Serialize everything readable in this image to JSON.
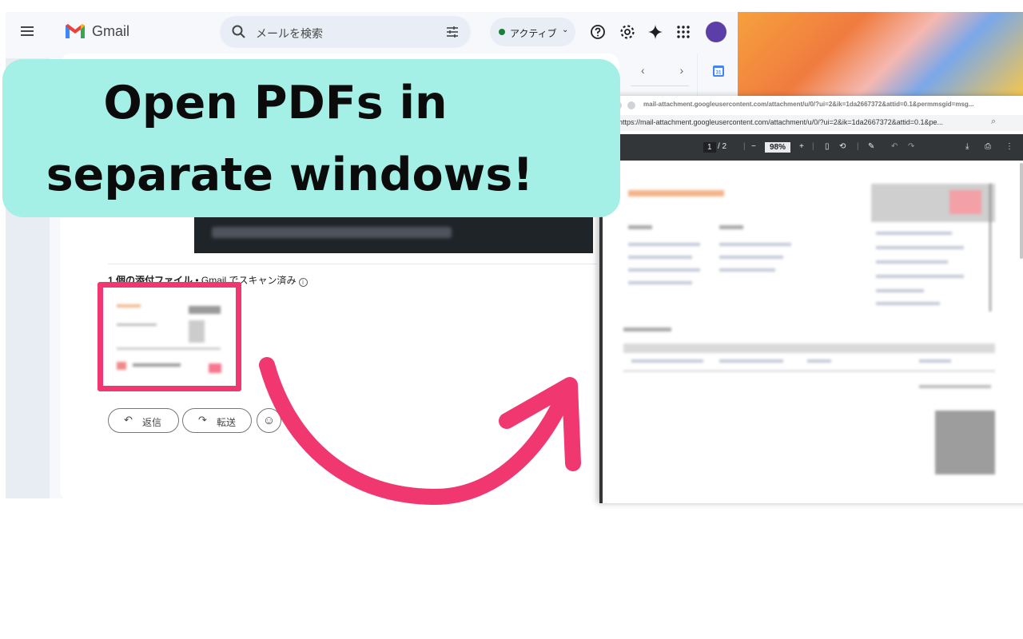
{
  "headline": {
    "line1": "Open PDFs in",
    "line2": "separate windows!"
  },
  "gmail": {
    "app_name": "Gmail",
    "search_placeholder": "メールを検索",
    "status_label": "アクティブ",
    "attachment_count_label": "1 個の添付ファイル",
    "attachment_separator": " • ",
    "attachment_scan_label": "Gmail でスキャン済み",
    "reply_label": "返信",
    "forward_label": "転送",
    "calendar_badge": "31",
    "icons": [
      "menu-icon",
      "search-icon",
      "filter-icon",
      "help-icon",
      "gear-icon",
      "sparkle-icon",
      "apps-grid-icon",
      "emoji-icon",
      "reply-icon",
      "forward-icon"
    ]
  },
  "pdf_window": {
    "title": "mail-attachment.googleusercontent.com/attachment/u/0/?ui=2&ik=1da2667372&attid=0.1&permmsgid=msg...",
    "url": "https://mail-attachment.googleusercontent.com/attachment/u/0/?ui=2&ik=1da2667372&attid=0.1&pe...",
    "page_current": "1",
    "page_total": "/ 2",
    "zoom": "98%"
  },
  "colors": {
    "callout_bg": "#a4efe6",
    "highlight": "#f0376f",
    "arrow": "#f0376f"
  }
}
